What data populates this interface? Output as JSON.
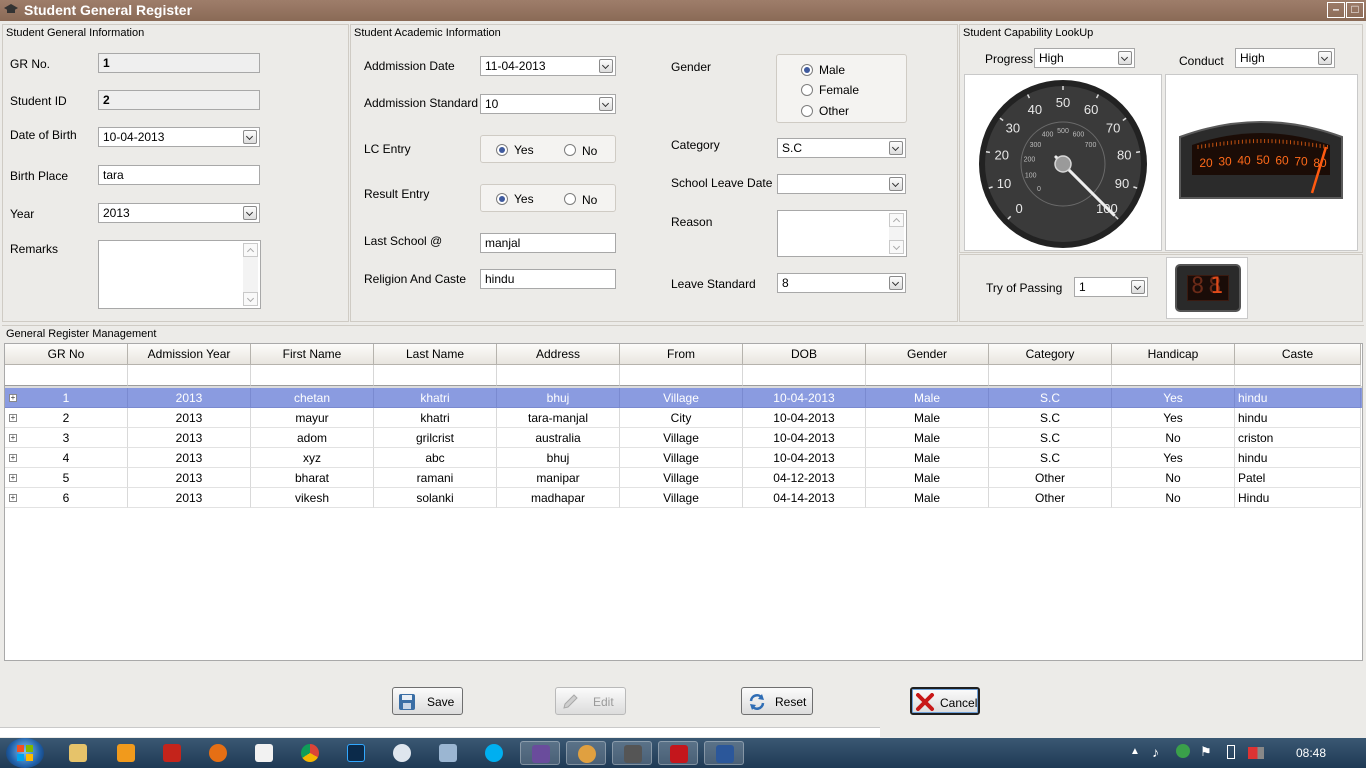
{
  "window": {
    "title": "Student General Register"
  },
  "general": {
    "title": "Student General Information",
    "gr_label": "GR No.",
    "gr_value": "1",
    "sid_label": "Student ID",
    "sid_value": "2",
    "dob_label": "Date of Birth",
    "dob_value": "10-04-2013",
    "bp_label": "Birth Place",
    "bp_value": "tara",
    "year_label": "Year",
    "year_value": "2013",
    "remarks_label": "Remarks",
    "remarks_value": ""
  },
  "academic": {
    "title": "Student Academic Information",
    "admdate_label": "Addmission Date",
    "admdate_value": "11-04-2013",
    "admstd_label": "Addmission Standard",
    "admstd_value": "10",
    "lc_label": "LC Entry",
    "lc_yes": "Yes",
    "lc_no": "No",
    "result_label": "Result Entry",
    "result_yes": "Yes",
    "result_no": "No",
    "lastschool_label": "Last School @",
    "lastschool_value": "manjal",
    "religion_label": "Religion And Caste",
    "religion_value": "hindu",
    "gender_label": "Gender",
    "gender_male": "Male",
    "gender_female": "Female",
    "gender_other": "Other",
    "category_label": "Category",
    "category_value": "S.C",
    "sld_label": "School Leave Date",
    "sld_value": "",
    "reason_label": "Reason",
    "leavestd_label": "Leave Standard",
    "leavestd_value": "8"
  },
  "capability": {
    "title": "Student Capability LookUp",
    "progress_label": "Progress",
    "progress_value": "High",
    "conduct_label": "Conduct",
    "conduct_value": "High",
    "gauge_outer": [
      "0",
      "10",
      "20",
      "30",
      "40",
      "50",
      "60",
      "70",
      "80",
      "90",
      "100"
    ],
    "gauge_inner": [
      "0",
      "100",
      "200",
      "300",
      "400",
      "500",
      "600",
      "700"
    ],
    "gauge_value": 100,
    "bar_ticks": [
      "20",
      "30",
      "40",
      "50",
      "60",
      "70",
      "80"
    ],
    "bar_value": 80,
    "try_label": "Try of Passing",
    "try_value": "1",
    "digital_value": "1"
  },
  "grid": {
    "title": "General Register Management",
    "columns": [
      "GR No",
      "Admission Year",
      "First Name",
      "Last Name",
      "Address",
      "From",
      "DOB",
      "Gender",
      "Category",
      "Handicap",
      "Caste"
    ],
    "rows": [
      [
        "1",
        "2013",
        "chetan",
        "khatri",
        "bhuj",
        "Village",
        "10-04-2013",
        "Male",
        "S.C",
        "Yes",
        "hindu"
      ],
      [
        "2",
        "2013",
        "mayur",
        "khatri",
        "tara-manjal",
        "City",
        "10-04-2013",
        "Male",
        "S.C",
        "Yes",
        "hindu"
      ],
      [
        "3",
        "2013",
        "adom",
        "grilcrist",
        "australia",
        "Village",
        "10-04-2013",
        "Male",
        "S.C",
        "No",
        "criston"
      ],
      [
        "4",
        "2013",
        "xyz",
        "abc",
        "bhuj",
        "Village",
        "10-04-2013",
        "Male",
        "S.C",
        "Yes",
        "hindu"
      ],
      [
        "5",
        "2013",
        "bharat",
        "ramani",
        "manipar",
        "Village",
        "04-12-2013",
        "Male",
        "Other",
        "No",
        "Patel"
      ],
      [
        "6",
        "2013",
        "vikesh",
        "solanki",
        "madhapar",
        "Village",
        "04-14-2013",
        "Male",
        "Other",
        "No",
        "Hindu"
      ]
    ]
  },
  "buttons": {
    "save": "Save",
    "edit": "Edit",
    "reset": "Reset",
    "cancel": "Cancel"
  },
  "taskbar": {
    "clock": "08:48"
  }
}
